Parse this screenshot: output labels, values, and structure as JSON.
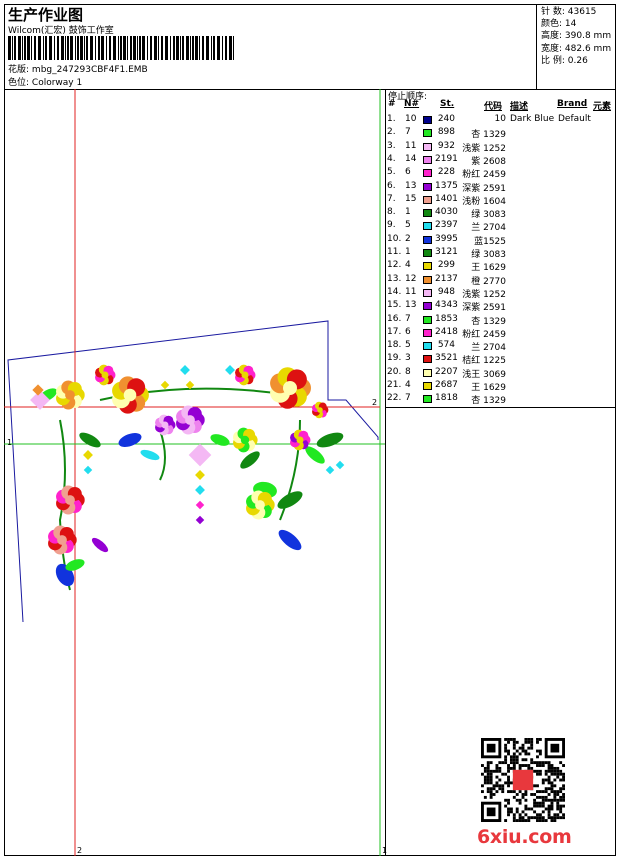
{
  "header": {
    "title": "生产作业图",
    "company": "Wilcom(汇宏) 鼓饰工作室",
    "design_label": "花版:",
    "design_file": "mbg_247293CBF4F1.EMB",
    "colorway_label": "色位:",
    "colorway_value": "Colorway 1"
  },
  "stats": [
    {
      "label": "针 数:",
      "value": "43615"
    },
    {
      "label": "颜色:",
      "value": "14"
    },
    {
      "label": "高度:",
      "value": "390.8 mm"
    },
    {
      "label": "宽度:",
      "value": "482.6 mm"
    },
    {
      "label": "比 例:",
      "value": "0.26"
    }
  ],
  "stop_sequence": {
    "title": "停止顺序:",
    "headers": {
      "index": "#",
      "n": "N#",
      "st": "St.",
      "code": "代码",
      "desc": "描述",
      "brand": "Brand",
      "element": "元素"
    },
    "rows": [
      {
        "i": "1.",
        "n": "10",
        "color": "#00008b",
        "st": "240",
        "code": "10",
        "desc": "Dark Blue",
        "brand": "Default"
      },
      {
        "i": "2.",
        "n": "7",
        "color": "#22e822",
        "st": "898",
        "code": "杏 1329",
        "desc": "",
        "brand": ""
      },
      {
        "i": "3.",
        "n": "11",
        "color": "#f4b8f4",
        "st": "932",
        "code": "浅紫 1252",
        "desc": "",
        "brand": ""
      },
      {
        "i": "4.",
        "n": "14",
        "color": "#ee82ee",
        "st": "2191",
        "code": "紫 2608",
        "desc": "",
        "brand": ""
      },
      {
        "i": "5.",
        "n": "6",
        "color": "#ff22cc",
        "st": "228",
        "code": "粉红 2459",
        "desc": "",
        "brand": ""
      },
      {
        "i": "6.",
        "n": "13",
        "color": "#9400d3",
        "st": "1375",
        "code": "深紫 2591",
        "desc": "",
        "brand": ""
      },
      {
        "i": "7.",
        "n": "15",
        "color": "#f0a090",
        "st": "1401",
        "code": "浅粉 1604",
        "desc": "",
        "brand": ""
      },
      {
        "i": "8.",
        "n": "1",
        "color": "#118811",
        "st": "4030",
        "code": "绿 3083",
        "desc": "",
        "brand": ""
      },
      {
        "i": "9.",
        "n": "5",
        "color": "#22ddee",
        "st": "2397",
        "code": "兰 2704",
        "desc": "",
        "brand": ""
      },
      {
        "i": "10.",
        "n": "2",
        "color": "#1133dd",
        "st": "3995",
        "code": "蓝1525",
        "desc": "",
        "brand": ""
      },
      {
        "i": "11.",
        "n": "1",
        "color": "#118811",
        "st": "3121",
        "code": "绿 3083",
        "desc": "",
        "brand": ""
      },
      {
        "i": "12.",
        "n": "4",
        "color": "#e8d800",
        "st": "299",
        "code": "王 1629",
        "desc": "",
        "brand": ""
      },
      {
        "i": "13.",
        "n": "12",
        "color": "#f09030",
        "st": "2137",
        "code": "橙 2770",
        "desc": "",
        "brand": ""
      },
      {
        "i": "14.",
        "n": "11",
        "color": "#f4b8f4",
        "st": "948",
        "code": "浅紫 1252",
        "desc": "",
        "brand": ""
      },
      {
        "i": "15.",
        "n": "13",
        "color": "#9400d3",
        "st": "4343",
        "code": "深紫 2591",
        "desc": "",
        "brand": ""
      },
      {
        "i": "16.",
        "n": "7",
        "color": "#22e822",
        "st": "1853",
        "code": "杏 1329",
        "desc": "",
        "brand": ""
      },
      {
        "i": "17.",
        "n": "6",
        "color": "#ff22cc",
        "st": "2418",
        "code": "粉红 2459",
        "desc": "",
        "brand": ""
      },
      {
        "i": "18.",
        "n": "5",
        "color": "#22ddee",
        "st": "574",
        "code": "兰 2704",
        "desc": "",
        "brand": ""
      },
      {
        "i": "19.",
        "n": "3",
        "color": "#dd1111",
        "st": "3521",
        "code": "桔红 1225",
        "desc": "",
        "brand": ""
      },
      {
        "i": "20.",
        "n": "8",
        "color": "#ffffb0",
        "st": "2207",
        "code": "浅王 3069",
        "desc": "",
        "brand": ""
      },
      {
        "i": "21.",
        "n": "4",
        "color": "#e8d800",
        "st": "2687",
        "code": "王 1629",
        "desc": "",
        "brand": ""
      },
      {
        "i": "22.",
        "n": "7",
        "color": "#22e822",
        "st": "1818",
        "code": "杏 1329",
        "desc": "",
        "brand": ""
      }
    ]
  },
  "markers": {
    "one": "1",
    "two": "2"
  },
  "watermark": "6xiu.com"
}
